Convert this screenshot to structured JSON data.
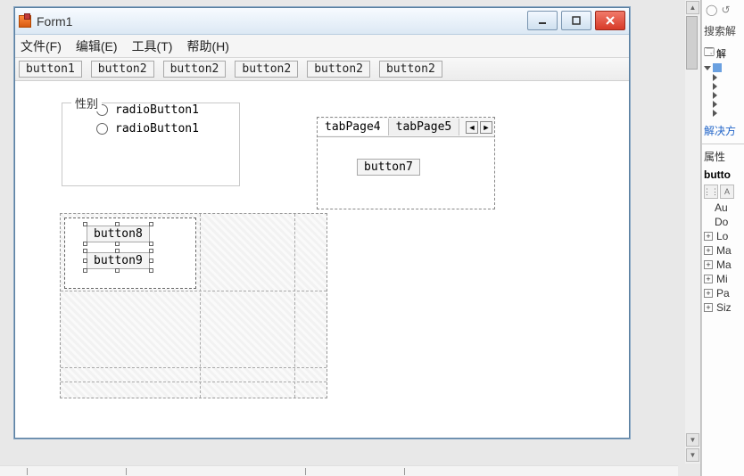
{
  "window": {
    "title": "Form1"
  },
  "menubar": {
    "file": "文件(F)",
    "edit": "编辑(E)",
    "tools": "工具(T)",
    "help": "帮助(H)"
  },
  "toolstrip": {
    "btn1": "button1",
    "btn2": "button2",
    "btn3": "button2",
    "btn4": "button2",
    "btn5": "button2",
    "btn6": "button2"
  },
  "groupbox": {
    "title": "性别",
    "radio1": "radioButton1",
    "radio2": "radioButton1"
  },
  "tabs": {
    "tab1": "tabPage4",
    "tab2": "tabPage5",
    "button7": "button7"
  },
  "tlp": {
    "button8": "button8",
    "button9": "button9"
  },
  "rightPanel": {
    "search": "搜索解",
    "solutionExplorer": "解",
    "solveLink": "解决方",
    "properties": "属性",
    "selected": "butto",
    "props": {
      "au": "Au",
      "do": "Do",
      "lo": "Lo",
      "ma1": "Ma",
      "ma2": "Ma",
      "mi": "Mi",
      "pa": "Pa",
      "siz": "Siz"
    }
  }
}
